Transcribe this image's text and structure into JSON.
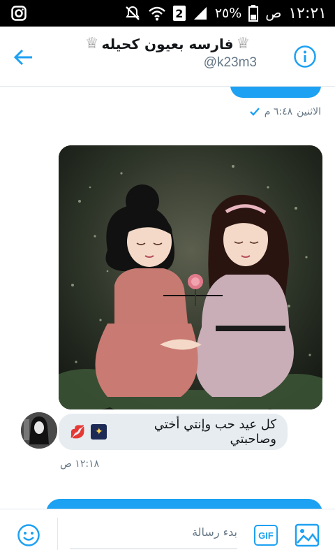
{
  "status_bar": {
    "time": "١٢:٢١",
    "am_pm": "ص",
    "battery": "٢٥%",
    "sim_badge": "2",
    "icons": [
      "instagram-icon",
      "mute-icon",
      "wifi-icon",
      "signal-icon",
      "battery-icon"
    ]
  },
  "header": {
    "contact_name": "فارسه بعيون كحيله",
    "handle": "@k23m3",
    "icons": [
      "back-arrow-icon",
      "crown-icon",
      "info-icon"
    ],
    "accent": "#1da1f2"
  },
  "conversation": {
    "sent_meta": {
      "day": "الاثنين",
      "time": "٦:٤٨ م"
    },
    "received": {
      "text": "كل عيد حب وإنتي أختي وصاحبتي",
      "emojis": [
        "night-sky-emoji",
        "kiss-lips-emoji"
      ],
      "time": "١٢:١٨ ص"
    },
    "colors": {
      "sent_bubble": "#1da1f2",
      "received_bubble": "#e6ecf0",
      "meta_text": "#657786"
    }
  },
  "composer": {
    "placeholder": "بدء رسالة",
    "gif_label": "GIF",
    "icons": [
      "emoji-icon",
      "gif-icon",
      "image-icon"
    ]
  }
}
